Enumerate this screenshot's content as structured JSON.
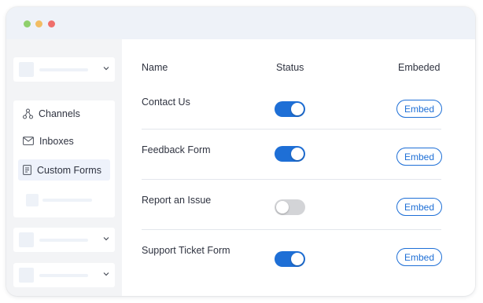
{
  "sidebar": {
    "menu": [
      {
        "label": "Channels",
        "icon": "channels-icon"
      },
      {
        "label": "Inboxes",
        "icon": "mail-icon"
      },
      {
        "label": "Custom Forms",
        "icon": "form-icon",
        "active": true
      }
    ]
  },
  "table": {
    "headers": {
      "name": "Name",
      "status": "Status",
      "embed": "Embeded"
    },
    "rows": [
      {
        "name": "Contact Us",
        "status": true,
        "action": "Embed"
      },
      {
        "name": "Feedback Form",
        "status": true,
        "action": "Embed"
      },
      {
        "name": "Report an Issue",
        "status": false,
        "action": "Embed"
      },
      {
        "name": "Support Ticket Form",
        "status": true,
        "action": "Embed"
      }
    ]
  },
  "colors": {
    "accent": "#1e6fd6",
    "toggle_off": "#d3d4d7",
    "active_item_bg": "#eef2fb"
  }
}
